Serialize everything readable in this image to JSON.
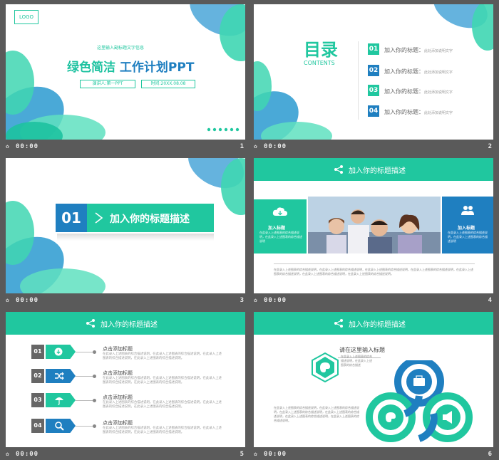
{
  "slides": [
    {
      "number": "1",
      "time": "00:00",
      "logo": "LOGO",
      "subtitle": "这里输入副标题文字信息",
      "title_part1": "绿色简洁",
      "title_part2": "工作计划PPT",
      "speaker": "演讲人:第一PPT",
      "date": "时间:20XX.08.08"
    },
    {
      "number": "2",
      "time": "00:00",
      "title": "目录",
      "subtitle": "CONTENTS",
      "items": [
        {
          "num": "01",
          "label": "加入你的标题：",
          "sub": "此处添加说明文字"
        },
        {
          "num": "02",
          "label": "加入你的标题：",
          "sub": "此处添加说明文字"
        },
        {
          "num": "03",
          "label": "加入你的标题：",
          "sub": "此处添加说明文字"
        },
        {
          "num": "04",
          "label": "加入你的标题：",
          "sub": "此处添加说明文字"
        }
      ]
    },
    {
      "number": "3",
      "time": "00:00",
      "section_num": "01",
      "section_title": "加入你的标题描述"
    },
    {
      "number": "4",
      "time": "00:00",
      "header": "加入你的标题描述",
      "left_title": "加入标题",
      "left_text": "在此录入上述图表的综合描述说明，在此录入上述图表的综合描述说明",
      "right_title": "加入标题",
      "right_text": "在此录入上述图表的综合描述说明，在此录入上述图表的综合描述说明",
      "bottom_text": "在此录入上述图表的综合描述说明，在此录入上述图表的综合描述说明，在此录入上述图表的综合描述说明，在此录入上述图表的综合描述说明，在此录入上述图表的综合描述说明，在此录入上述图表的综合描述说明，在此录入上述图表的综合描述说明。"
    },
    {
      "number": "5",
      "time": "00:00",
      "header": "加入你的标题描述",
      "items": [
        {
          "num": "01",
          "title": "点击添加标题",
          "body": "在此录入上述图表的综合描述说明，在此录入上述图表的综合描述说明，在此录入上述图表的综合描述说明，在此录入上述图表的综合描述说明。"
        },
        {
          "num": "02",
          "title": "点击添加标题",
          "body": "在此录入上述图表的综合描述说明，在此录入上述图表的综合描述说明，在此录入上述图表的综合描述说明，在此录入上述图表的综合描述说明。"
        },
        {
          "num": "03",
          "title": "点击添加标题",
          "body": "在此录入上述图表的综合描述说明，在此录入上述图表的综合描述说明，在此录入上述图表的综合描述说明，在此录入上述图表的综合描述说明。"
        },
        {
          "num": "04",
          "title": "点击添加标题",
          "body": "在此录入上述图表的综合描述说明，在此录入上述图表的综合描述说明，在此录入上述图表的综合描述说明，在此录入上述图表的综合描述说明。"
        }
      ]
    },
    {
      "number": "6",
      "time": "00:00",
      "header": "加入你的标题描述",
      "callout_title": "请在这里输入标题",
      "callout_text": "在此录入上述图表的综合描述说明，在此录入上述图表的综合描述",
      "bottom_text": "在此录入上述图表的综合描述说明，在此录入上述图表的综合描述说明，在此录入上述图表的综合描述说明，在此录入上述图表的综合描述说明，在此录入上述图表的综合描述说明，在此录入上述图表的综合描述说明。"
    }
  ],
  "colors": {
    "teal": "#20c79f",
    "blue": "#1f7fc0",
    "gray": "#5a5a5a"
  }
}
